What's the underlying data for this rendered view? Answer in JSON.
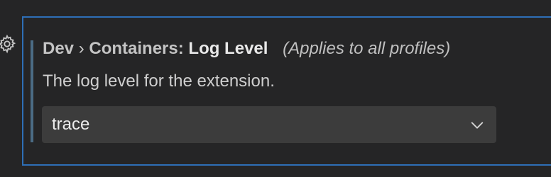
{
  "setting": {
    "category_prefix": "Dev",
    "separator": "›",
    "category": "Containers:",
    "key": "Log Level",
    "scope_note": "(Applies to all profiles)",
    "description": "The log level for the extension.",
    "dropdown": {
      "selected": "trace"
    }
  },
  "icons": {
    "gear": "gear-icon",
    "chevron": "chevron-down-icon"
  },
  "colors": {
    "focus_border": "#2e6fb7",
    "modified_indicator": "#4b6b84",
    "dropdown_bg": "#3c3c3c",
    "background": "#252526"
  }
}
